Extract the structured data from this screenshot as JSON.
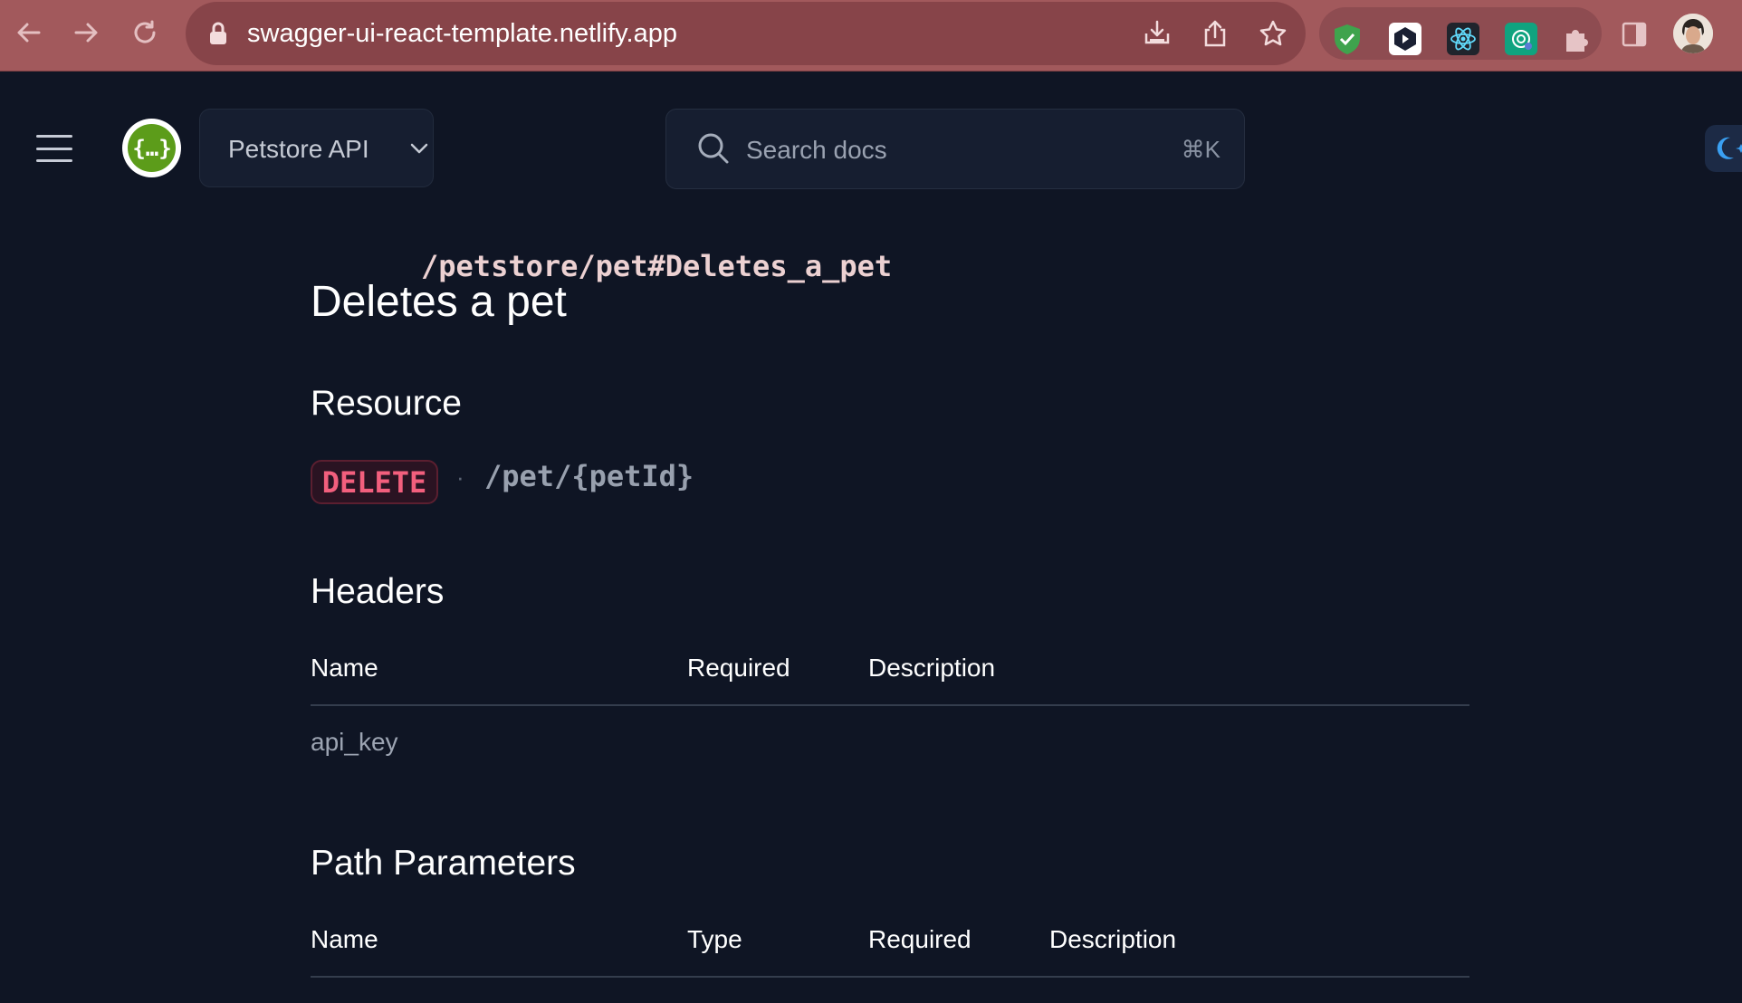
{
  "browser": {
    "url_host": "swagger-ui-react-template.netlify.app",
    "url_path": "/petstore/pet#Deletes_a_pet"
  },
  "header": {
    "api_selector": "Petstore API",
    "search_placeholder": "Search docs",
    "search_shortcut": "⌘K"
  },
  "page": {
    "title": "Deletes a pet",
    "resource_heading": "Resource",
    "method": "DELETE",
    "separator": "·",
    "path": "/pet/{petId}",
    "headers_heading": "Headers",
    "headers_table": {
      "columns": [
        "Name",
        "Required",
        "Description"
      ],
      "rows": [
        {
          "name": "api_key",
          "required": "",
          "description": ""
        }
      ]
    },
    "path_params_heading": "Path Parameters",
    "path_params_table": {
      "columns": [
        "Name",
        "Type",
        "Required",
        "Description"
      ]
    }
  },
  "colors": {
    "background": "#0f1524",
    "browser_chrome": "#a2595c",
    "method_delete": "#f25f7d",
    "logo_green": "#5c9c1a"
  },
  "icons": [
    "back-icon",
    "forward-icon",
    "reload-icon",
    "lock-icon",
    "install-icon",
    "share-icon",
    "star-icon",
    "shield-extension-icon",
    "play-extension-icon",
    "react-extension-icon",
    "gpt-extension-icon",
    "puzzle-icon",
    "sidepanel-icon",
    "hamburger-icon",
    "swagger-logo-icon",
    "chevron-down-icon",
    "search-icon",
    "theme-toggle-icon"
  ]
}
